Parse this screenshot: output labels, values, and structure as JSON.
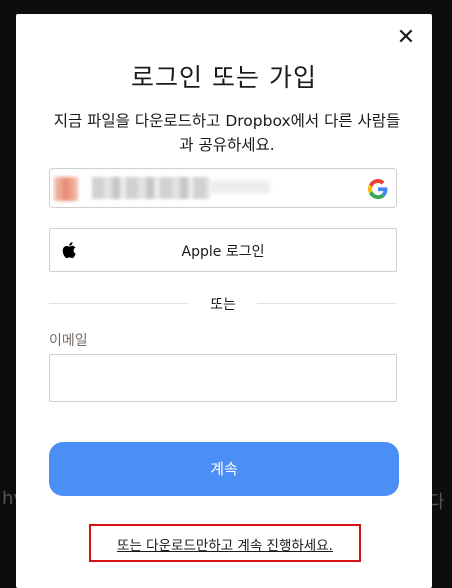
{
  "background": {
    "left_fragment": "hv",
    "right_fragment": "다"
  },
  "modal": {
    "title": "로그인 또는 가입",
    "subtitle": "지금 파일을 다운로드하고 Dropbox에서 다른 사람들과 공유하세요.",
    "google_button": {
      "icon": "google-g-icon"
    },
    "apple_button": {
      "label": "Apple 로그인",
      "icon": "apple-icon"
    },
    "divider_text": "또는",
    "email": {
      "label": "이메일",
      "value": "",
      "placeholder": ""
    },
    "continue_label": "계속",
    "download_link": "또는 다운로드만하고 계속 진행하세요.",
    "close_icon": "close-icon"
  },
  "colors": {
    "primary": "#4b8ef5",
    "highlight_border": "#d41414",
    "text": "#1e1919",
    "muted": "#736c64"
  }
}
